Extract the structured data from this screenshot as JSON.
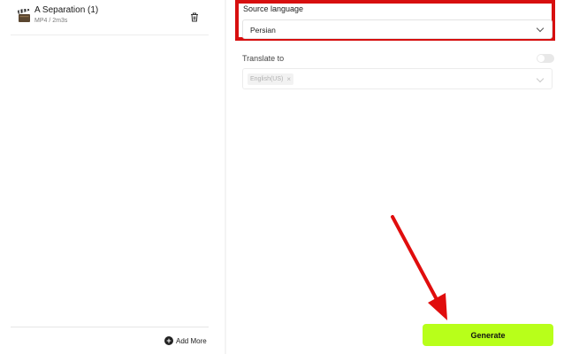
{
  "files": [
    {
      "name": "A Separation (1)",
      "meta": "MP4 / 2m3s",
      "icon": "clapperboard-icon"
    }
  ],
  "left": {
    "add_more_label": "Add More"
  },
  "source": {
    "label": "Source language",
    "value": "Persian"
  },
  "translate": {
    "label": "Translate to",
    "chip": "English(US)",
    "chip_remove": "×",
    "enabled": false
  },
  "generate": {
    "label": "Generate"
  },
  "colors": {
    "accent": "#b8ff1a",
    "annotation": "#d70f0f"
  }
}
